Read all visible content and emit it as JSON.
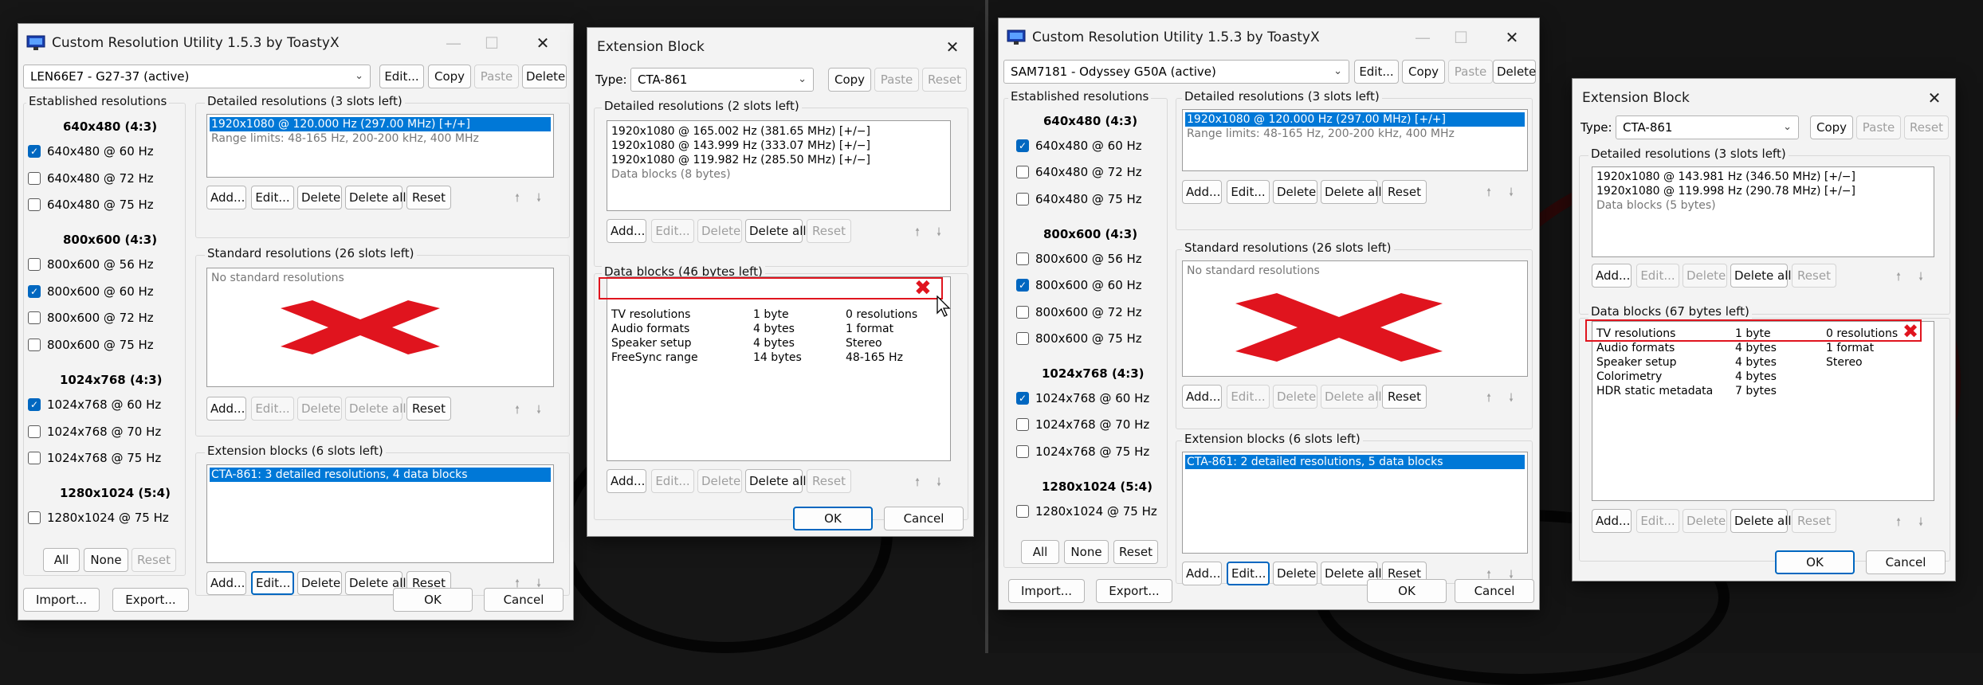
{
  "screens": [
    {
      "main": {
        "title": "Custom Resolution Utility 1.5.3 by ToastyX",
        "monitor": "LEN66E7 - G27-37 (active)",
        "top_buttons": {
          "edit": "Edit...",
          "copy": "Copy",
          "paste": "Paste",
          "delete": "Delete"
        },
        "established": {
          "title": "Established resolutions",
          "groups": [
            {
              "heading": "640x480 (4:3)",
              "items": [
                {
                  "label": "640x480 @ 60 Hz",
                  "checked": true
                },
                {
                  "label": "640x480 @ 72 Hz",
                  "checked": false
                },
                {
                  "label": "640x480 @ 75 Hz",
                  "checked": false
                }
              ]
            },
            {
              "heading": "800x600 (4:3)",
              "items": [
                {
                  "label": "800x600 @ 56 Hz",
                  "checked": false
                },
                {
                  "label": "800x600 @ 60 Hz",
                  "checked": true
                },
                {
                  "label": "800x600 @ 72 Hz",
                  "checked": false
                },
                {
                  "label": "800x600 @ 75 Hz",
                  "checked": false
                }
              ]
            },
            {
              "heading": "1024x768 (4:3)",
              "items": [
                {
                  "label": "1024x768 @ 60 Hz",
                  "checked": true
                },
                {
                  "label": "1024x768 @ 70 Hz",
                  "checked": false
                },
                {
                  "label": "1024x768 @ 75 Hz",
                  "checked": false
                }
              ]
            },
            {
              "heading": "1280x1024 (5:4)",
              "items": [
                {
                  "label": "1280x1024 @ 75 Hz",
                  "checked": false
                }
              ]
            }
          ],
          "buttons": {
            "all": "All",
            "none": "None",
            "reset": "Reset"
          }
        },
        "detailed": {
          "title": "Detailed resolutions (3 slots left)",
          "rows": [
            {
              "text": "1920x1080 @ 120.000 Hz (297.00 MHz) [+/+]",
              "selected": true
            },
            {
              "text": "Range limits: 48-165 Hz, 200-200 kHz, 400 MHz",
              "gray": true
            }
          ]
        },
        "standard": {
          "title": "Standard resolutions (26 slots left)",
          "empty_text": "No standard resolutions"
        },
        "extension": {
          "title": "Extension blocks (6 slots left)",
          "rows": [
            {
              "text": "CTA-861: 3 detailed resolutions, 4 data blocks",
              "selected": true
            }
          ]
        },
        "list_buttons": {
          "add": "Add...",
          "edit": "Edit...",
          "delete": "Delete",
          "delete_all": "Delete all",
          "reset": "Reset"
        },
        "bottom": {
          "import": "Import...",
          "export": "Export...",
          "ok": "OK",
          "cancel": "Cancel"
        }
      },
      "ext": {
        "title": "Extension Block",
        "type_label": "Type:",
        "type_value": "CTA-861",
        "buttons": {
          "copy": "Copy",
          "paste": "Paste",
          "reset": "Reset"
        },
        "detailed": {
          "title": "Detailed resolutions (2 slots left)",
          "rows": [
            {
              "text": "1920x1080 @ 165.002 Hz (381.65 MHz) [+/−]"
            },
            {
              "text": "1920x1080 @ 143.999 Hz (333.07 MHz) [+/−]"
            },
            {
              "text": "1920x1080 @ 119.982 Hz (285.50 MHz) [+/−]"
            },
            {
              "text": "Data blocks (8 bytes)",
              "gray": true
            }
          ]
        },
        "data_blocks": {
          "title": "Data blocks (46 bytes left)",
          "rows": [
            {
              "name": "TV resolutions",
              "size": "1 byte",
              "info": "0 resolutions"
            },
            {
              "name": "Audio formats",
              "size": "4 bytes",
              "info": "1 format"
            },
            {
              "name": "Speaker setup",
              "size": "4 bytes",
              "info": "Stereo"
            },
            {
              "name": "FreeSync range",
              "size": "14 bytes",
              "info": "48-165 Hz"
            }
          ]
        },
        "list_buttons": {
          "add": "Add...",
          "edit": "Edit...",
          "delete": "Delete",
          "delete_all": "Delete all",
          "reset": "Reset"
        },
        "bottom": {
          "ok": "OK",
          "cancel": "Cancel"
        }
      }
    },
    {
      "main": {
        "title": "Custom Resolution Utility 1.5.3 by ToastyX",
        "monitor": "SAM7181 - Odyssey G50A (active)",
        "top_buttons": {
          "edit": "Edit...",
          "copy": "Copy",
          "paste": "Paste",
          "delete": "Delete"
        },
        "established": {
          "title": "Established resolutions",
          "groups": [
            {
              "heading": "640x480 (4:3)",
              "items": [
                {
                  "label": "640x480 @ 60 Hz",
                  "checked": true
                },
                {
                  "label": "640x480 @ 72 Hz",
                  "checked": false
                },
                {
                  "label": "640x480 @ 75 Hz",
                  "checked": false
                }
              ]
            },
            {
              "heading": "800x600 (4:3)",
              "items": [
                {
                  "label": "800x600 @ 56 Hz",
                  "checked": false
                },
                {
                  "label": "800x600 @ 60 Hz",
                  "checked": true
                },
                {
                  "label": "800x600 @ 72 Hz",
                  "checked": false
                },
                {
                  "label": "800x600 @ 75 Hz",
                  "checked": false
                }
              ]
            },
            {
              "heading": "1024x768 (4:3)",
              "items": [
                {
                  "label": "1024x768 @ 60 Hz",
                  "checked": true
                },
                {
                  "label": "1024x768 @ 70 Hz",
                  "checked": false
                },
                {
                  "label": "1024x768 @ 75 Hz",
                  "checked": false
                }
              ]
            },
            {
              "heading": "1280x1024 (5:4)",
              "items": [
                {
                  "label": "1280x1024 @ 75 Hz",
                  "checked": false
                }
              ]
            }
          ],
          "buttons": {
            "all": "All",
            "none": "None",
            "reset": "Reset"
          }
        },
        "detailed": {
          "title": "Detailed resolutions (3 slots left)",
          "rows": [
            {
              "text": "1920x1080 @ 120.000 Hz (297.00 MHz) [+/+]",
              "selected": true
            },
            {
              "text": "Range limits: 48-165 Hz, 200-200 kHz, 400 MHz",
              "gray": true
            }
          ]
        },
        "standard": {
          "title": "Standard resolutions (26 slots left)",
          "empty_text": "No standard resolutions"
        },
        "extension": {
          "title": "Extension blocks (6 slots left)",
          "rows": [
            {
              "text": "CTA-861: 2 detailed resolutions, 5 data blocks",
              "selected": true
            }
          ]
        },
        "list_buttons": {
          "add": "Add...",
          "edit": "Edit...",
          "delete": "Delete",
          "delete_all": "Delete all",
          "reset": "Reset"
        },
        "bottom": {
          "import": "Import...",
          "export": "Export...",
          "ok": "OK",
          "cancel": "Cancel"
        }
      },
      "ext": {
        "title": "Extension Block",
        "type_label": "Type:",
        "type_value": "CTA-861",
        "buttons": {
          "copy": "Copy",
          "paste": "Paste",
          "reset": "Reset"
        },
        "detailed": {
          "title": "Detailed resolutions (3 slots left)",
          "rows": [
            {
              "text": "1920x1080 @ 143.981 Hz (346.50 MHz) [+/−]"
            },
            {
              "text": "1920x1080 @ 119.998 Hz (290.78 MHz) [+/−]"
            },
            {
              "text": "Data blocks (5 bytes)",
              "gray": true
            }
          ]
        },
        "data_blocks": {
          "title": "Data blocks (67 bytes left)",
          "rows": [
            {
              "name": "TV resolutions",
              "size": "1 byte",
              "info": "0 resolutions"
            },
            {
              "name": "Audio formats",
              "size": "4 bytes",
              "info": "1 format"
            },
            {
              "name": "Speaker setup",
              "size": "4 bytes",
              "info": "Stereo"
            },
            {
              "name": "Colorimetry",
              "size": "4 bytes",
              "info": ""
            },
            {
              "name": "HDR static metadata",
              "size": "7 bytes",
              "info": ""
            }
          ]
        },
        "list_buttons": {
          "add": "Add...",
          "edit": "Edit...",
          "delete": "Delete",
          "delete_all": "Delete all",
          "reset": "Reset"
        },
        "bottom": {
          "ok": "OK",
          "cancel": "Cancel"
        }
      }
    }
  ],
  "colors": {
    "accent": "#0067c0",
    "selection": "#0078d7",
    "annotation_red": "#e0141e",
    "dialog_bg": "#f3f3f3"
  }
}
